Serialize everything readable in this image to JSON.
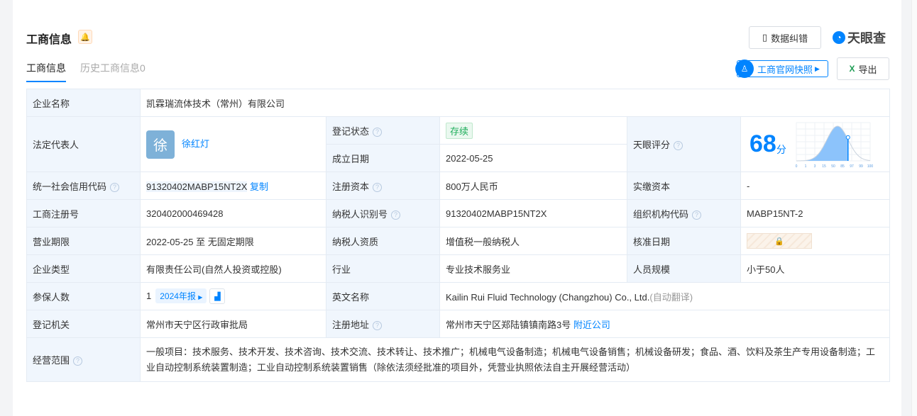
{
  "header": {
    "title": "工商信息",
    "correct_label": "数据纠错",
    "logo": "天眼查",
    "snapshot_label": "工商官网快照",
    "export_label": "导出"
  },
  "tabs": [
    {
      "label": "工商信息"
    },
    {
      "label": "历史工商信息0"
    }
  ],
  "rows": {
    "company_name_label": "企业名称",
    "company_name": "凯霖瑞流体技术（常州）有限公司",
    "legal_rep_label": "法定代表人",
    "legal_rep_avatar": "徐",
    "legal_rep": "徐红灯",
    "reg_status_label": "登记状态",
    "reg_status": "存续",
    "found_date_label": "成立日期",
    "found_date": "2022-05-25",
    "score_label": "天眼评分",
    "score": "68",
    "score_unit": "分",
    "credit_code_label": "统一社会信用代码",
    "credit_code": "91320402MABP15NT2X",
    "copy_label": "复制",
    "reg_capital_label": "注册资本",
    "reg_capital": "800万人民币",
    "paid_capital_label": "实缴资本",
    "paid_capital": "-",
    "reg_no_label": "工商注册号",
    "reg_no": "320402000469428",
    "taxpayer_id_label": "纳税人识别号",
    "taxpayer_id": "91320402MABP15NT2X",
    "org_code_label": "组织机构代码",
    "org_code": "MABP15NT-2",
    "term_label": "营业期限",
    "term": "2022-05-25 至 无固定期限",
    "taxpayer_qual_label": "纳税人资质",
    "taxpayer_qual": "增值税一般纳税人",
    "approve_date_label": "核准日期",
    "type_label": "企业类型",
    "type": "有限责任公司(自然人投资或控股)",
    "industry_label": "行业",
    "industry": "专业技术服务业",
    "staff_label": "人员规模",
    "staff": "小于50人",
    "insured_label": "参保人数",
    "insured": "1",
    "report_label": "2024年报",
    "en_name_label": "英文名称",
    "en_name": "Kailin Rui Fluid Technology (Changzhou) Co., Ltd.",
    "auto_translate": "(自动翻译)",
    "authority_label": "登记机关",
    "authority": "常州市天宁区行政审批局",
    "address_label": "注册地址",
    "address": "常州市天宁区郑陆镇镇南路3号",
    "nearby_label": "附近公司",
    "scope_label": "经营范围",
    "scope": "一般项目：技术服务、技术开发、技术咨询、技术交流、技术转让、技术推广；机械电气设备制造；机械电气设备销售；机械设备研发；食品、酒、饮料及茶生产专用设备制造；工业自动控制系统装置制造；工业自动控制系统装置销售（除依法须经批准的项目外，凭营业执照依法自主开展经营活动）"
  },
  "score_chart": {
    "ticks": [
      "0",
      "1",
      "3",
      "15",
      "50",
      "85",
      "97",
      "99",
      "100"
    ],
    "score": 68
  }
}
